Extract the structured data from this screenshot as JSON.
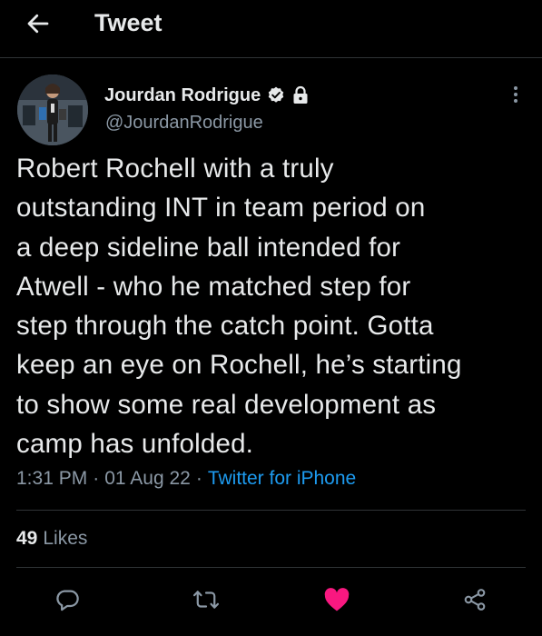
{
  "header": {
    "title": "Tweet",
    "back_icon": "arrow-left-icon"
  },
  "tweet": {
    "author": {
      "display_name": "Jourdan Rodrigue",
      "handle": "@JourdanRodrigue",
      "badges": [
        "verified-badge-icon",
        "lock-icon"
      ]
    },
    "text": "Robert Rochell with a truly\noutstanding INT in team period on\na deep sideline ball intended for\nAtwell - who he matched step for\nstep through the catch point. Gotta\nkeep an eye on Rochell, he’s starting\nto show some real development as\ncamp has unfolded.",
    "time": "1:31 PM",
    "date": "01 Aug 22",
    "separator": "·",
    "source": "Twitter for iPhone",
    "likes_count": "49",
    "likes_label": "Likes",
    "liked": true
  },
  "actions": [
    {
      "name": "reply",
      "icon": "reply-icon"
    },
    {
      "name": "retweet",
      "icon": "retweet-icon"
    },
    {
      "name": "like",
      "icon": "heart-icon"
    },
    {
      "name": "share",
      "icon": "share-icon"
    }
  ],
  "colors": {
    "background": "#000000",
    "text": "#e7e9ea",
    "secondary_text": "#8b98a5",
    "link": "#1d9bf0",
    "like": "#f91880",
    "divider": "#2f3336"
  }
}
